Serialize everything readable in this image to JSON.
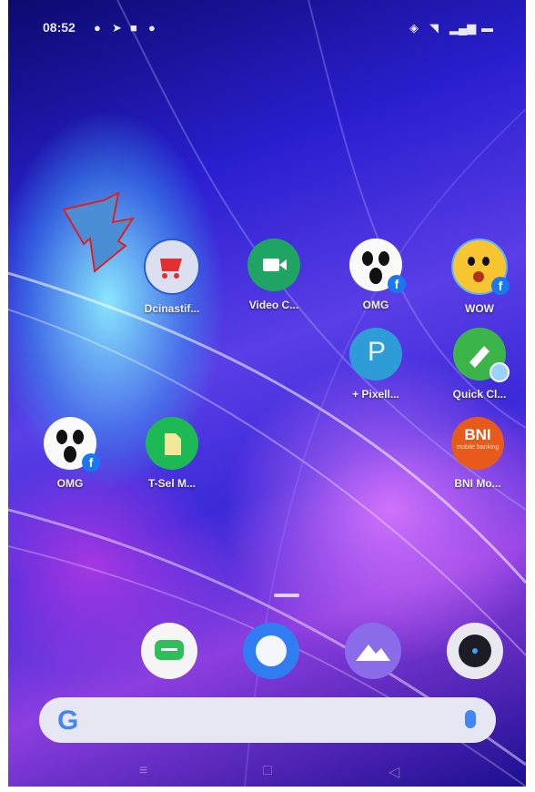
{
  "status_bar": {
    "time": "08:52"
  },
  "apps": [
    {
      "label": "Dcinastif...",
      "icon": "shopping-cart-icon"
    },
    {
      "label": "Video C...",
      "icon": "video-camera-icon"
    },
    {
      "label": "OMG",
      "icon": "omg-face-icon"
    },
    {
      "label": "WOW",
      "icon": "wow-face-icon"
    },
    {
      "label": "+ Pixell...",
      "icon": "pixel-p-icon"
    },
    {
      "label": "Quick Cl...",
      "icon": "broom-icon"
    },
    {
      "label": "OMG",
      "icon": "omg-face-icon"
    },
    {
      "label": "T-Sel M...",
      "icon": "sim-card-icon"
    },
    {
      "label": "BNI Mo...",
      "icon": "bni-logo-icon"
    }
  ],
  "bni_logo": {
    "line1": "BNI",
    "line2": "mobile banking"
  },
  "dock": [
    {
      "name": "messages",
      "icon": "message-icon"
    },
    {
      "name": "browser",
      "icon": "browser-icon"
    },
    {
      "name": "gallery",
      "icon": "gallery-icon"
    },
    {
      "name": "camera",
      "icon": "camera-icon"
    }
  ],
  "search": {
    "logo": "G"
  },
  "colors": {
    "arrow": "#e02020",
    "video": "#1fa463",
    "tsel": "#1db954",
    "bni": "#e85a1a",
    "pixel": "#2e9cd6",
    "quick": "#3bb54a"
  }
}
